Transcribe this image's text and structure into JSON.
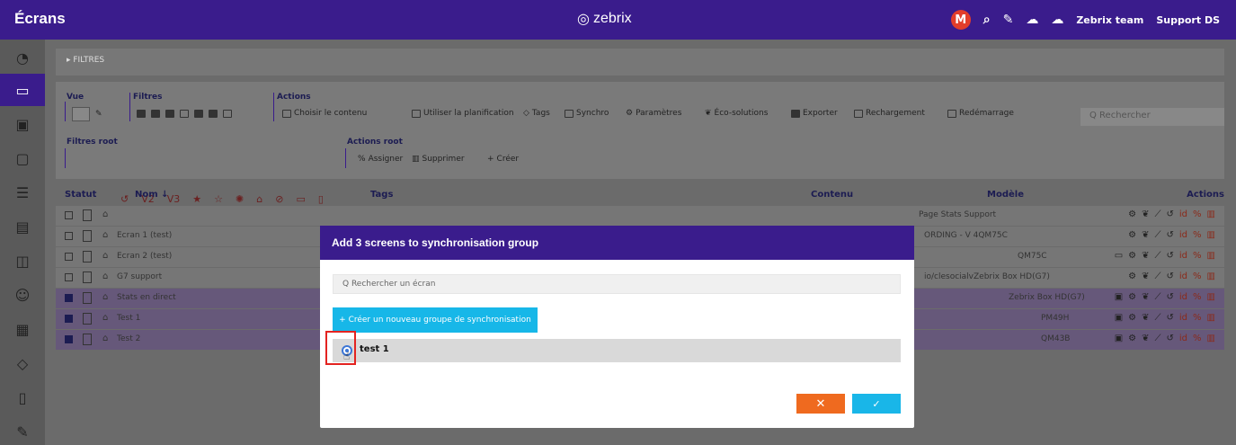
{
  "topbar": {
    "page_title": "Écrans",
    "brand": "zebrix",
    "avatar_letter": "M",
    "team_label": "Zebrix team",
    "support_label": "Support DS"
  },
  "toolbar": {
    "filtres_label": "▸ FILTRES",
    "vue_label": "Vue",
    "filtres_group_label": "Filtres",
    "actions_label": "Actions",
    "actions": {
      "choisir": "Choisir le contenu",
      "planification": "Utiliser la planification",
      "tags": "Tags",
      "synchro": "Synchro",
      "parametres": "Paramètres",
      "eco": "Éco-solutions",
      "exporter": "Exporter",
      "rechargement": "Rechargement",
      "redemarrage": "Redémarrage"
    },
    "search_placeholder": "Q Rechercher",
    "filtres_root_label": "Filtres root",
    "actions_root_label": "Actions root",
    "root_actions": {
      "assigner": "Assigner",
      "supprimer": "Supprimer",
      "creer": "Créer"
    },
    "root_filter_labels": {
      "v2": "V2",
      "v3": "V3"
    }
  },
  "table": {
    "headers": {
      "statut": "Statut",
      "nom": "Nom ↓",
      "tags": "Tags",
      "contenu": "Contenu",
      "modele": "Modèle",
      "actions": "Actions"
    },
    "rows": [
      {
        "name": "",
        "contenu": "Page Stats Support",
        "modele": "",
        "selected": false
      },
      {
        "name": "Ecran 1 (test)",
        "contenu": "",
        "modele": "ORDING - V 4QM75C",
        "selected": false
      },
      {
        "name": "Ecran 2 (test)",
        "contenu": "",
        "modele": "QM75C",
        "selected": false
      },
      {
        "name": "G7 support",
        "contenu": "",
        "modele": "io/clesocialvZebrix Box HD(G7)",
        "selected": false
      },
      {
        "name": "Stats en direct",
        "contenu": "",
        "modele": "Zebrix Box HD(G7)",
        "selected": true
      },
      {
        "name": "Test 1",
        "contenu": "",
        "modele": "PM49H",
        "selected": true
      },
      {
        "name": "Test 2",
        "contenu": "",
        "modele": "QM43B",
        "selected": true
      }
    ]
  },
  "modal": {
    "title": "Add 3 screens to synchronisation group",
    "search_placeholder": "Q Rechercher un écran",
    "create_button": "+ Créer un nouveau groupe de synchronisation",
    "groups": [
      {
        "label": "test 1",
        "selected": true
      }
    ],
    "cancel_label": "✕",
    "ok_label": "✓"
  },
  "colors": {
    "brand_purple": "#3a1c8c",
    "cyan": "#17b7e8",
    "orange": "#ef6a1f",
    "highlight_red": "#e32320"
  }
}
